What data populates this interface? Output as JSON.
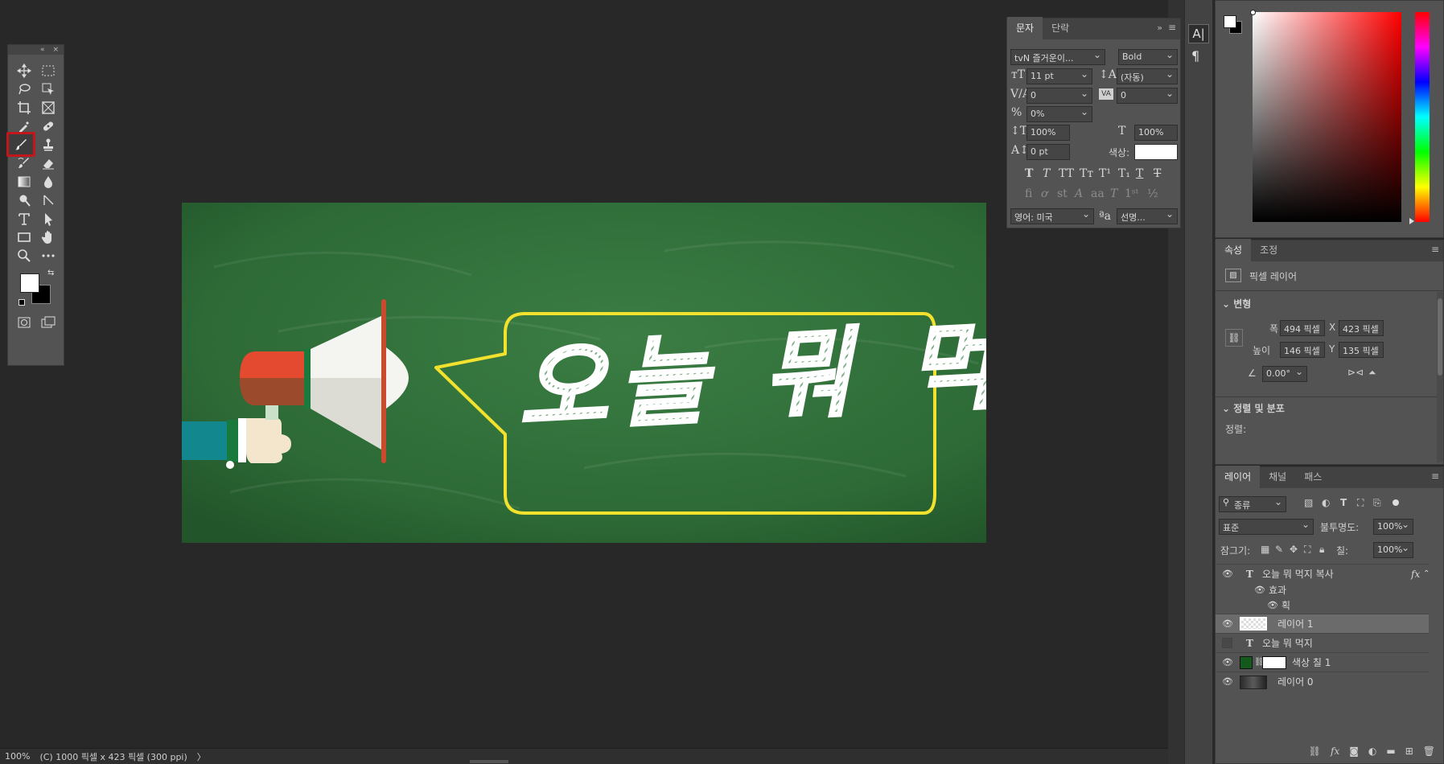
{
  "app": {
    "accent": "#c0161c"
  },
  "tools": {
    "panel_controls": [
      "«",
      "×"
    ],
    "active": "brush-tool"
  },
  "document": {
    "headline": "오늘 뭐 먹지",
    "bg_color": "#2c6a35",
    "bubble_stroke": "#f2e22e"
  },
  "character_panel": {
    "tabs": [
      "문자",
      "단락"
    ],
    "font_family": "tvN 즐거운이...",
    "font_style": "Bold",
    "font_size": "11 pt",
    "leading": "(자동)",
    "kerning": "0",
    "tracking": "0",
    "tsume": "0%",
    "vertical_scale": "100%",
    "horizontal_scale": "100%",
    "baseline_shift": "0 pt",
    "color_label": "색상:",
    "language": "영어: 미국",
    "antialias": "선명..."
  },
  "properties_panel": {
    "tabs": [
      "속성",
      "조정"
    ],
    "layer_kind": "픽셀 레이어",
    "transform_header": "변형",
    "width_label": "폭",
    "width": "494 픽셀",
    "x_label": "X",
    "x": "423 픽셀",
    "height_label": "높이",
    "height": "146 픽셀",
    "y_label": "Y",
    "y": "135 픽셀",
    "angle": "0.00°",
    "align_header": "정렬 및 분포",
    "align_label": "정렬:"
  },
  "layers_panel": {
    "tabs": [
      "레이어",
      "채널",
      "패스"
    ],
    "filter": "종류",
    "blend_mode": "표준",
    "opacity_label": "불투명도:",
    "opacity": "100%",
    "lock_label": "잠그기:",
    "fill_label": "칠:",
    "fill": "100%",
    "layers": [
      {
        "name": "오늘 뭐 먹지 복사",
        "kind": "text",
        "visible": true,
        "fx": "fx"
      },
      {
        "name": "효과",
        "kind": "effects",
        "visible": true
      },
      {
        "name": "획",
        "kind": "effect",
        "visible": true
      },
      {
        "name": "레이어 1",
        "kind": "pixel",
        "visible": true,
        "selected": true
      },
      {
        "name": "오늘 뭐 먹지",
        "kind": "text",
        "visible": false
      },
      {
        "name": "색상 칠 1",
        "kind": "fill",
        "visible": true,
        "color": "#145a1c"
      },
      {
        "name": "레이어 0",
        "kind": "pixel",
        "visible": true
      }
    ]
  },
  "status": {
    "zoom": "100%",
    "doc_info": "(C) 1000 픽셀 x 423 픽셀 (300 ppi)",
    "arrow": "〉"
  }
}
